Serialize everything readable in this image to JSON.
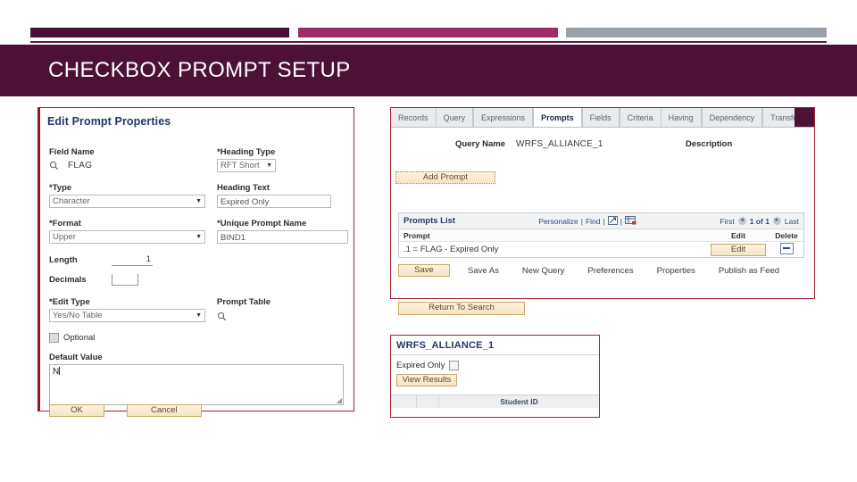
{
  "slide": {
    "title": "CHECKBOX PROMPT SETUP"
  },
  "edit_prompt_properties": {
    "header": "Edit Prompt Properties",
    "field_name_label": "Field Name",
    "field_name_value": "FLAG",
    "search_icon": "magnifier-icon",
    "type_label": "*Type",
    "type_value": "Character",
    "format_label": "*Format",
    "format_value": "Upper",
    "length_label": "Length",
    "length_value": "1",
    "decimals_label": "Decimals",
    "decimals_value": "",
    "edit_type_label": "*Edit Type",
    "edit_type_value": "Yes/No Table",
    "optional_label": "Optional",
    "default_value_label": "Default Value",
    "default_value": "N",
    "heading_type_label": "*Heading Type",
    "heading_type_value": "RFT Short",
    "heading_text_label": "Heading Text",
    "heading_text_value": "Expired Only",
    "unique_prompt_name_label": "*Unique Prompt Name",
    "unique_prompt_name_value": "BIND1",
    "prompt_table_label": "Prompt Table",
    "prompt_table_icon": "magnifier-icon",
    "ok_button": "OK",
    "cancel_button": "Cancel"
  },
  "query_manager": {
    "tabs": [
      {
        "label": "Records",
        "active": false
      },
      {
        "label": "Query",
        "active": false
      },
      {
        "label": "Expressions",
        "active": false
      },
      {
        "label": "Prompts",
        "active": true
      },
      {
        "label": "Fields",
        "active": false
      },
      {
        "label": "Criteria",
        "active": false
      },
      {
        "label": "Having",
        "active": false
      },
      {
        "label": "Dependency",
        "active": false
      },
      {
        "label": "Transform",
        "active": false
      }
    ],
    "query_name_label": "Query Name",
    "query_name_value": "WRFS_ALLIANCE_1",
    "description_label": "Description",
    "add_prompt_button": "Add Prompt",
    "prompts_list": {
      "title": "Prompts List",
      "personalize_link": "Personalize",
      "find_link": "Find",
      "view_all_icon": "view-all-icon",
      "download_icon": "download-spreadsheet-icon",
      "first_link": "First",
      "prev_icon": "previous-arrow-icon",
      "page_indicator": "1 of 1",
      "next_icon": "next-arrow-icon",
      "last_link": "Last",
      "columns": [
        "Prompt",
        "Edit",
        "Delete"
      ],
      "rows": [
        {
          "prompt": ".1 = FLAG - Expired Only",
          "edit_button": "Edit",
          "delete_icon": "delete-minus-icon"
        }
      ]
    },
    "save_button": "Save",
    "action_links": [
      "Save As",
      "New Query",
      "Preferences",
      "Properties",
      "Publish as Feed"
    ],
    "return_to_search_button": "Return To Search"
  },
  "runtime_prompt": {
    "title": "WRFS_ALLIANCE_1",
    "checkbox_label": "Expired Only",
    "checkbox_checked": false,
    "view_results_button": "View Results",
    "results_columns": [
      "",
      "",
      "Student ID"
    ]
  },
  "colors": {
    "brand_dark": "#4d1136",
    "brand_pink": "#9d2d66",
    "brand_gray": "#9aa1a9",
    "panel_border_red": "#a8212e",
    "link_blue": "#2a4b8d"
  }
}
